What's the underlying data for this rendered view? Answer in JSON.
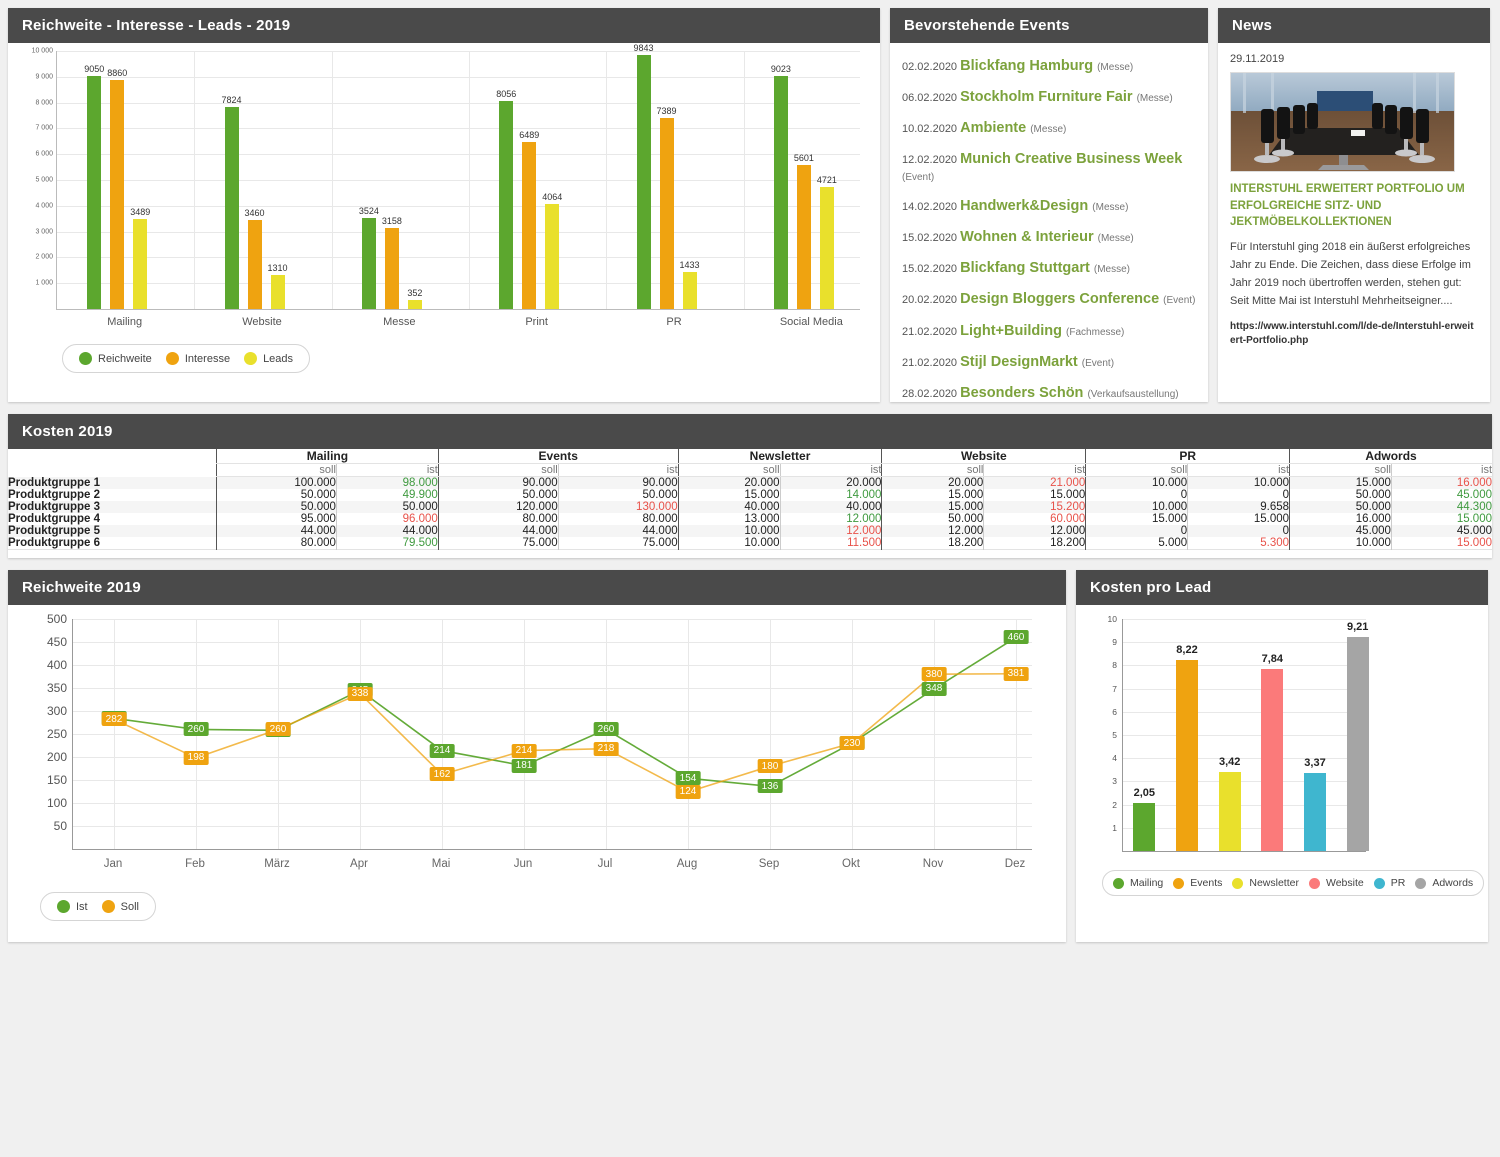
{
  "bars_panel": {
    "title": "Reichweite - Interesse - Leads - 2019",
    "legend": [
      {
        "label": "Reichweite",
        "color": "#5ca72e"
      },
      {
        "label": "Interesse",
        "color": "#efa310"
      },
      {
        "label": "Leads",
        "color": "#e9e02c"
      }
    ]
  },
  "events_panel": {
    "title": "Bevorstehende Events",
    "items": [
      {
        "date": "02.02.2020",
        "name": "Blickfang Hamburg",
        "type": "(Messe)"
      },
      {
        "date": "06.02.2020",
        "name": "Stockholm Furniture Fair",
        "type": "(Messe)"
      },
      {
        "date": "10.02.2020",
        "name": "Ambiente",
        "type": "(Messe)"
      },
      {
        "date": "12.02.2020",
        "name": "Munich Creative Business Week",
        "type": "(Event)"
      },
      {
        "date": "14.02.2020",
        "name": "Handwerk&Design",
        "type": "(Messe)"
      },
      {
        "date": "15.02.2020",
        "name": "Wohnen & Interieur",
        "type": "(Messe)"
      },
      {
        "date": "15.02.2020",
        "name": "Blickfang Stuttgart",
        "type": "(Messe)"
      },
      {
        "date": "20.02.2020",
        "name": "Design Bloggers Conference",
        "type": "(Event)"
      },
      {
        "date": "21.02.2020",
        "name": "Light+Building",
        "type": "(Fachmesse)"
      },
      {
        "date": "21.02.2020",
        "name": "Stijl DesignMarkt",
        "type": "(Event)"
      },
      {
        "date": "28.02.2020",
        "name": "Besonders Schön",
        "type": "(Verkaufsaustellung)"
      }
    ]
  },
  "news_panel": {
    "title": "News",
    "date": "29.11.2019",
    "headline": "INTERSTUHL ERWEITERT PORTFOLIO UM ERFOLGREICHE SITZ- UND JEKTMÖBELKOLLEKTIONEN",
    "body": "Für Interstuhl ging 2018 ein äußerst erfolgreiches Jahr zu Ende. Die Zeichen, dass diese Erfolge im Jahr 2019 noch übertroffen werden, stehen gut: Seit Mitte Mai ist Interstuhl Mehrheitseigner....",
    "url": "https://www.interstuhl.com/l/de-de/Interstuhl-erweitert-Portfolio.php"
  },
  "costs_panel": {
    "title": "Kosten 2019",
    "groups": [
      "Mailing",
      "Events",
      "Newsletter",
      "Website",
      "PR",
      "Adwords"
    ],
    "sub_headers": [
      "soll",
      "ist"
    ],
    "rows": [
      {
        "label": "Produktgruppe 1",
        "cells": [
          {
            "v": "100.000",
            "s": "n"
          },
          {
            "v": "98.000",
            "s": "good"
          },
          {
            "v": "90.000",
            "s": "n"
          },
          {
            "v": "90.000",
            "s": "n"
          },
          {
            "v": "20.000",
            "s": "n"
          },
          {
            "v": "20.000",
            "s": "n"
          },
          {
            "v": "20.000",
            "s": "n"
          },
          {
            "v": "21.000",
            "s": "bad"
          },
          {
            "v": "10.000",
            "s": "n"
          },
          {
            "v": "10.000",
            "s": "n"
          },
          {
            "v": "15.000",
            "s": "n"
          },
          {
            "v": "16.000",
            "s": "bad"
          }
        ]
      },
      {
        "label": "Produktgruppe 2",
        "cells": [
          {
            "v": "50.000",
            "s": "n"
          },
          {
            "v": "49.900",
            "s": "good"
          },
          {
            "v": "50.000",
            "s": "n"
          },
          {
            "v": "50.000",
            "s": "n"
          },
          {
            "v": "15.000",
            "s": "n"
          },
          {
            "v": "14.000",
            "s": "good"
          },
          {
            "v": "15.000",
            "s": "n"
          },
          {
            "v": "15.000",
            "s": "n"
          },
          {
            "v": "0",
            "s": "n"
          },
          {
            "v": "0",
            "s": "n"
          },
          {
            "v": "50.000",
            "s": "n"
          },
          {
            "v": "45.000",
            "s": "good"
          }
        ]
      },
      {
        "label": "Produktgruppe 3",
        "cells": [
          {
            "v": "50.000",
            "s": "n"
          },
          {
            "v": "50.000",
            "s": "n"
          },
          {
            "v": "120.000",
            "s": "n"
          },
          {
            "v": "130.000",
            "s": "bad"
          },
          {
            "v": "40.000",
            "s": "n"
          },
          {
            "v": "40.000",
            "s": "n"
          },
          {
            "v": "15.000",
            "s": "n"
          },
          {
            "v": "15.200",
            "s": "bad"
          },
          {
            "v": "10.000",
            "s": "n"
          },
          {
            "v": "9.658",
            "s": "n"
          },
          {
            "v": "50.000",
            "s": "n"
          },
          {
            "v": "44.300",
            "s": "good"
          }
        ]
      },
      {
        "label": "Produktgruppe 4",
        "cells": [
          {
            "v": "95.000",
            "s": "n"
          },
          {
            "v": "96.000",
            "s": "bad"
          },
          {
            "v": "80.000",
            "s": "n"
          },
          {
            "v": "80.000",
            "s": "n"
          },
          {
            "v": "13.000",
            "s": "n"
          },
          {
            "v": "12.000",
            "s": "good"
          },
          {
            "v": "50.000",
            "s": "n"
          },
          {
            "v": "60.000",
            "s": "bad"
          },
          {
            "v": "15.000",
            "s": "n"
          },
          {
            "v": "15.000",
            "s": "n"
          },
          {
            "v": "16.000",
            "s": "n"
          },
          {
            "v": "15.000",
            "s": "good"
          }
        ]
      },
      {
        "label": "Produktgruppe 5",
        "cells": [
          {
            "v": "44.000",
            "s": "n"
          },
          {
            "v": "44.000",
            "s": "n"
          },
          {
            "v": "44.000",
            "s": "n"
          },
          {
            "v": "44.000",
            "s": "n"
          },
          {
            "v": "10.000",
            "s": "n"
          },
          {
            "v": "12.000",
            "s": "bad"
          },
          {
            "v": "12.000",
            "s": "n"
          },
          {
            "v": "12.000",
            "s": "n"
          },
          {
            "v": "0",
            "s": "n"
          },
          {
            "v": "0",
            "s": "n"
          },
          {
            "v": "45.000",
            "s": "n"
          },
          {
            "v": "45.000",
            "s": "n"
          }
        ]
      },
      {
        "label": "Produktgruppe 6",
        "cells": [
          {
            "v": "80.000",
            "s": "n"
          },
          {
            "v": "79.500",
            "s": "good"
          },
          {
            "v": "75.000",
            "s": "n"
          },
          {
            "v": "75.000",
            "s": "n"
          },
          {
            "v": "10.000",
            "s": "n"
          },
          {
            "v": "11.500",
            "s": "bad"
          },
          {
            "v": "18.200",
            "s": "n"
          },
          {
            "v": "18.200",
            "s": "n"
          },
          {
            "v": "5.000",
            "s": "n"
          },
          {
            "v": "5.300",
            "s": "bad"
          },
          {
            "v": "10.000",
            "s": "n"
          },
          {
            "v": "15.000",
            "s": "bad"
          }
        ]
      }
    ]
  },
  "line_panel": {
    "title": "Reichweite 2019",
    "legend": [
      {
        "label": "Ist",
        "color": "#5ca72e"
      },
      {
        "label": "Soll",
        "color": "#efa310"
      }
    ]
  },
  "cpl_panel": {
    "title": "Kosten pro Lead",
    "legend": [
      {
        "label": "Mailing",
        "color": "#5ca72e"
      },
      {
        "label": "Events",
        "color": "#efa310"
      },
      {
        "label": "Newsletter",
        "color": "#e9e02c"
      },
      {
        "label": "Website",
        "color": "#fb7islands"
      },
      {
        "label": "PR",
        "color": "#3fb6cf"
      },
      {
        "label": "Adwords",
        "color": "#a5a5a5"
      }
    ]
  },
  "chart_data": [
    {
      "type": "bar",
      "title": "Reichweite - Interesse - Leads - 2019",
      "categories": [
        "Mailing",
        "Website",
        "Messe",
        "Print",
        "PR",
        "Social Media"
      ],
      "series": [
        {
          "name": "Reichweite",
          "color": "#5ca72e",
          "values": [
            9050,
            7824,
            3524,
            8056,
            9843,
            9023
          ]
        },
        {
          "name": "Interesse",
          "color": "#efa310",
          "values": [
            8860,
            3460,
            3158,
            6489,
            7389,
            5601
          ]
        },
        {
          "name": "Leads",
          "color": "#e9e02c",
          "values": [
            3489,
            1310,
            352,
            4064,
            1433,
            4721
          ]
        }
      ],
      "xlabel": "",
      "ylabel": "",
      "ylim": [
        0,
        10000
      ],
      "yticks": [
        "1 000",
        "2 000",
        "3 000",
        "4 000",
        "5 000",
        "6 000",
        "7 000",
        "8 000",
        "9 000",
        "10 000"
      ],
      "grid": true,
      "legend_position": "bottom-left"
    },
    {
      "type": "line",
      "title": "Reichweite 2019",
      "categories": [
        "Jan",
        "Feb",
        "März",
        "Apr",
        "Mai",
        "Jun",
        "Jul",
        "Aug",
        "Sep",
        "Okt",
        "Nov",
        "Dez"
      ],
      "series": [
        {
          "name": "Ist",
          "color": "#5ca72e",
          "values": [
            284,
            260,
            258,
            345,
            214,
            181,
            260,
            154,
            136,
            230,
            348,
            460
          ]
        },
        {
          "name": "Soll",
          "color": "#efa310",
          "values": [
            282,
            198,
            260,
            338,
            162,
            214,
            218,
            124,
            180,
            230,
            380,
            381
          ]
        }
      ],
      "xlabel": "",
      "ylabel": "",
      "ylim": [
        0,
        500
      ],
      "yticks": [
        50,
        100,
        150,
        200,
        250,
        300,
        350,
        400,
        450,
        500
      ],
      "grid": true,
      "legend_position": "bottom-left"
    },
    {
      "type": "bar",
      "title": "Kosten pro Lead",
      "categories": [
        "Mailing",
        "Events",
        "Newsletter",
        "Website",
        "PR",
        "Adwords"
      ],
      "values": [
        2.05,
        8.22,
        3.42,
        7.84,
        3.37,
        9.21
      ],
      "value_labels": [
        "2,05",
        "8,22",
        "3,42",
        "7,84",
        "3,37",
        "9,21"
      ],
      "colors": [
        "#5ca72e",
        "#efa310",
        "#e9e02c",
        "#fb7a7a",
        "#3fb6cf",
        "#a5a5a5"
      ],
      "xlabel": "",
      "ylabel": "",
      "ylim": [
        0,
        10
      ],
      "yticks": [
        1,
        2,
        3,
        4,
        5,
        6,
        7,
        8,
        9,
        10
      ],
      "grid": true,
      "legend_position": "bottom"
    }
  ]
}
